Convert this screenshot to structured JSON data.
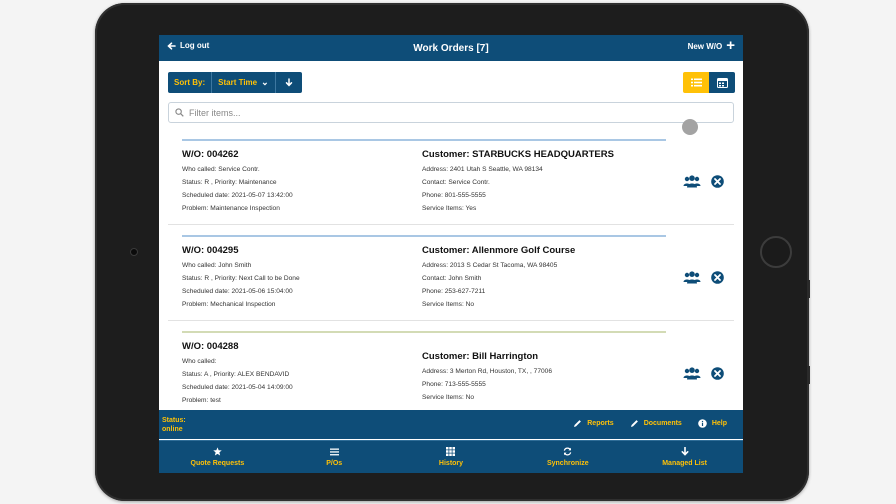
{
  "header": {
    "logout_label": "Log out",
    "title": "Work Orders [7]",
    "new_label": "New W/O"
  },
  "sort": {
    "label": "Sort By:",
    "value": "Start Time"
  },
  "filter": {
    "placeholder": "Filter items..."
  },
  "colors": {
    "primary": "#0e4d78",
    "accent": "#ffc107",
    "status_blue": "#a9c7e4",
    "status_green": "#d3dbb5"
  },
  "work_orders": [
    {
      "wo": "W/O: 004262",
      "who_called": "Who called: Service Contr.",
      "status_priority": "Status: R , Priority: Maintenance",
      "scheduled": "Scheduled date: 2021-05-07 13:42:00",
      "problem": "Problem: Maintenance Inspection",
      "customer": "Customer: STARBUCKS HEADQUARTERS",
      "address": "Address: 2401 Utah S Seattle, WA 98134",
      "contact": "Contact: Service Contr.",
      "phone": "Phone: 801-555-5555",
      "service_items": "Service Items: Yes"
    },
    {
      "wo": "W/O: 004295",
      "who_called": "Who called: John Smith",
      "status_priority": "Status: R , Priority: Next Call to be Done",
      "scheduled": "Scheduled date: 2021-05-06 15:04:00",
      "problem": "Problem: Mechanical Inspection",
      "customer": "Customer: Allenmore Golf Course",
      "address": "Address: 2013 S Cedar St Tacoma, WA 98405",
      "contact": "Contact: John Smith",
      "phone": "Phone: 253-627-7211",
      "service_items": "Service Items: No"
    },
    {
      "wo": "W/O: 004288",
      "who_called": "Who called:",
      "status_priority": "Status: A , Priority: ALEX BENDAVID",
      "scheduled": "Scheduled date: 2021-05-04 14:09:00",
      "problem": "Problem: test",
      "customer": "Customer: Bill Harrington",
      "address": "Address: 3 Merton Rd, Houston, TX, , 77006",
      "phone": "Phone: 713-555-5555",
      "service_items": "Service Items: No"
    }
  ],
  "status": {
    "label": "Status:",
    "value": "online"
  },
  "footer_links": {
    "reports": "Reports",
    "documents": "Documents",
    "help": "Help"
  },
  "tabs": {
    "quote_requests": "Quote Requests",
    "pos": "P/Os",
    "history": "History",
    "synchronize": "Synchronize",
    "managed_list": "Managed List"
  }
}
